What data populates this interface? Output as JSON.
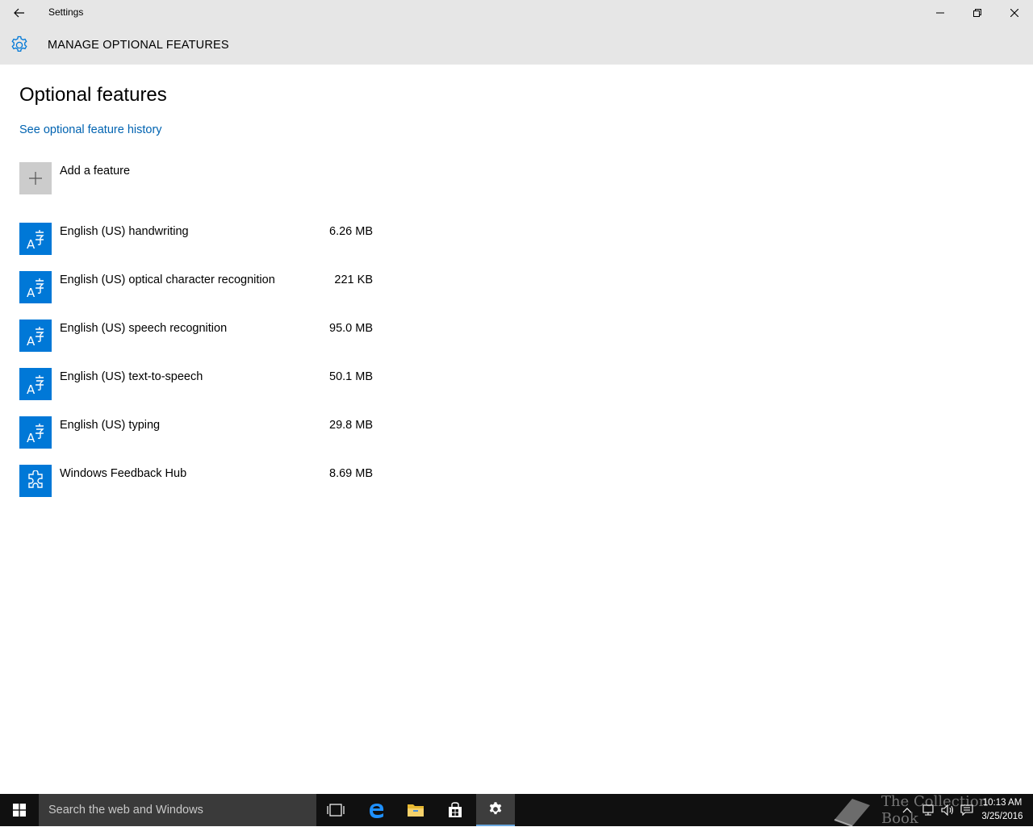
{
  "window": {
    "title": "Settings"
  },
  "header": {
    "title": "MANAGE OPTIONAL FEATURES"
  },
  "main": {
    "title": "Optional features",
    "history_link": "See optional feature history",
    "add_feature_label": "Add a feature",
    "features": [
      {
        "name": "English (US) handwriting",
        "size": "6.26 MB",
        "icon": "language-icon"
      },
      {
        "name": "English (US) optical character recognition",
        "size": "221 KB",
        "icon": "language-icon"
      },
      {
        "name": "English (US) speech recognition",
        "size": "95.0 MB",
        "icon": "language-icon"
      },
      {
        "name": "English (US) text-to-speech",
        "size": "50.1 MB",
        "icon": "language-icon"
      },
      {
        "name": "English (US) typing",
        "size": "29.8 MB",
        "icon": "language-icon"
      },
      {
        "name": "Windows Feedback Hub",
        "size": "8.69 MB",
        "icon": "puzzle-icon"
      }
    ]
  },
  "taskbar": {
    "search_placeholder": "Search the web and Windows",
    "time": "10:13 AM",
    "date": "3/25/2016",
    "watermark": "The Collection Book"
  },
  "colors": {
    "accent": "#0078d7",
    "link": "#0063b1",
    "chrome": "#e6e6e6",
    "taskbar": "#101010"
  }
}
